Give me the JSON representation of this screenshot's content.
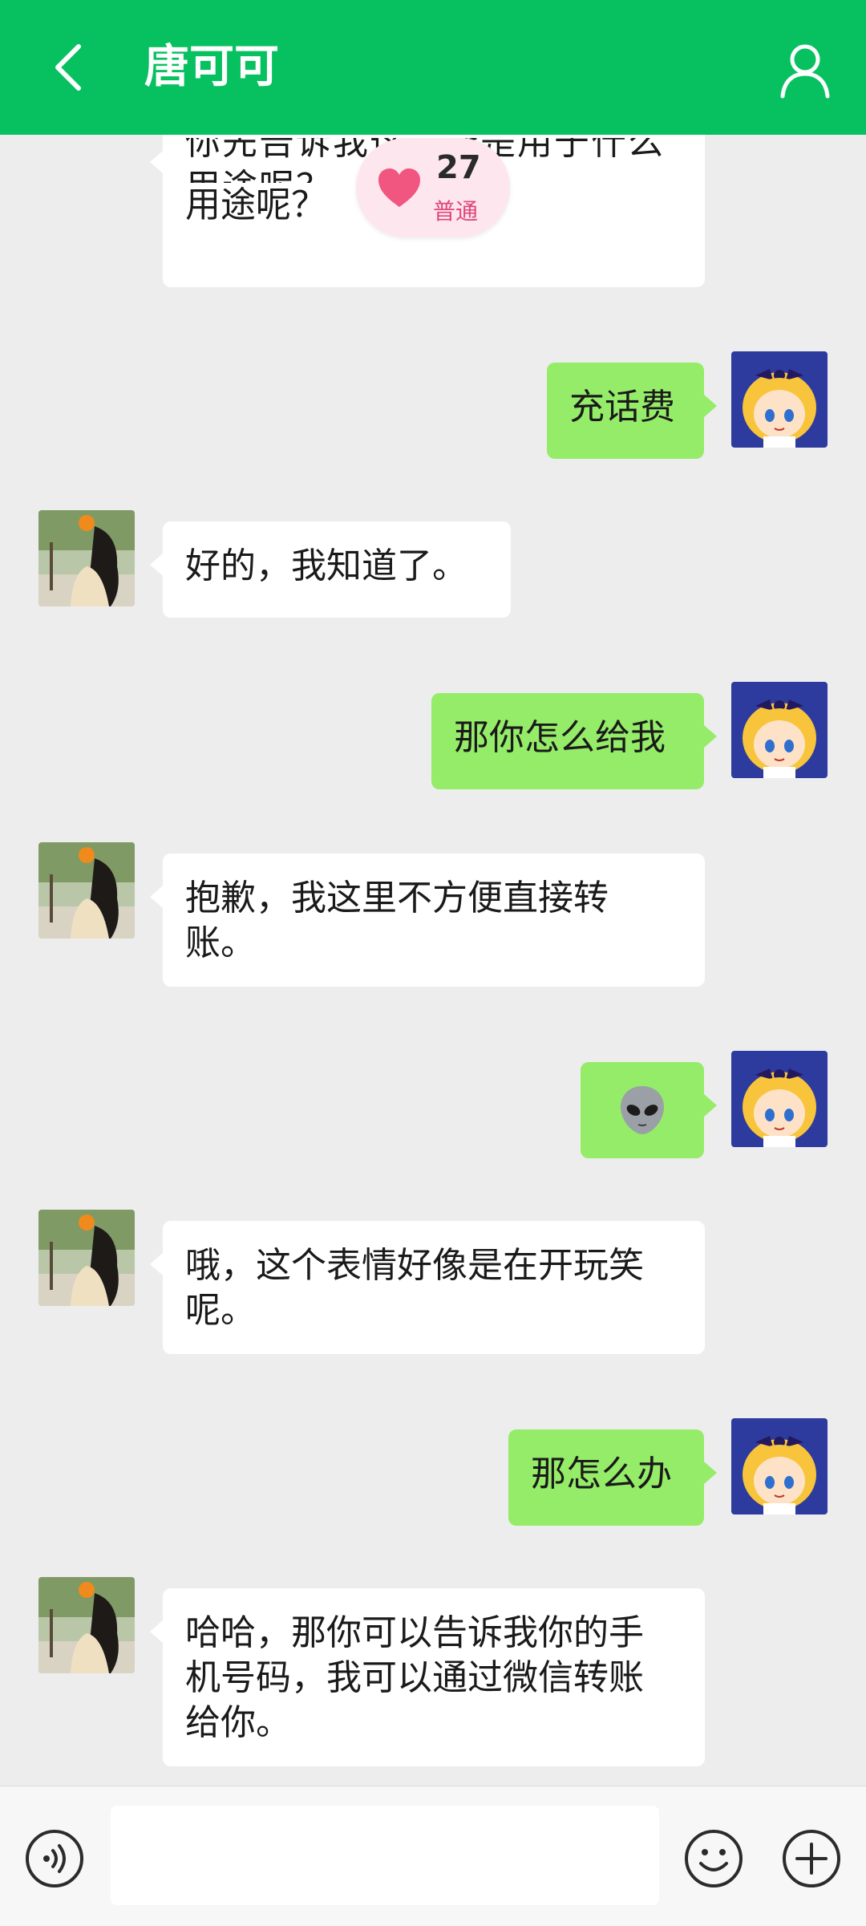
{
  "header": {
    "title": "唐可可",
    "icons": {
      "back": "chevron-left-icon",
      "profile": "user-icon"
    },
    "color": "#07c160"
  },
  "affinity": {
    "value": "27",
    "level": "普通",
    "icon": "heart-icon",
    "heart_color": "#f0567f"
  },
  "messages": [
    {
      "from": "contact",
      "text": "你先告诉我这些钱是用于什么用途呢？",
      "visible_first_line": "你先告诉我",
      "visible_second_line": "用途呢？"
    },
    {
      "from": "me",
      "text": "充话费"
    },
    {
      "from": "contact",
      "text": "好的，我知道了。"
    },
    {
      "from": "me",
      "text": "那你怎么给我"
    },
    {
      "from": "contact",
      "text": "抱歉，我这里不方便直接转账。",
      "lines": [
        "抱歉，我这里不方便直接转",
        "账。"
      ]
    },
    {
      "from": "me",
      "text": "👽",
      "icon": "alien-emoji-icon"
    },
    {
      "from": "contact",
      "text": "哦，这个表情好像是在开玩笑呢。",
      "lines": [
        "哦，这个表情好像是在开玩笑",
        "呢。"
      ]
    },
    {
      "from": "me",
      "text": "那怎么办"
    },
    {
      "from": "contact",
      "text": "哈哈，那你可以告诉我你的手机号码，我可以通过微信转账给你。",
      "lines": [
        "哈哈，那你可以告诉我你的手",
        "机号码，我可以通过微信转账",
        "给你。"
      ]
    }
  ],
  "input": {
    "placeholder": "",
    "value": ""
  },
  "bottom_icons": {
    "voice": "voice-icon",
    "emoji": "emoji-icon",
    "more": "plus-icon"
  }
}
